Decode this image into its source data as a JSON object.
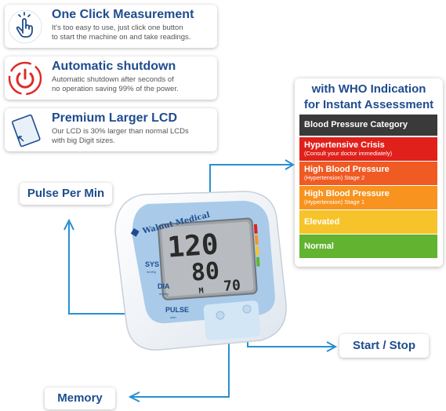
{
  "features": [
    {
      "title": "One Click Measurement",
      "line1": "It's too easy to use, just click one button",
      "line2": "to start the machine on and take readings.",
      "icon": "hand-click-icon"
    },
    {
      "title": "Automatic shutdown",
      "line1": "Automatic shutdown after seconds of",
      "line2": "no operation saving 99% of the power.",
      "icon": "power-icon"
    },
    {
      "title": "Premium Larger LCD",
      "line1": "Our LCD is 30% larger than normal LCDs",
      "line2": "with big Digit sizes.",
      "icon": "lcd-screen-icon"
    }
  ],
  "who": {
    "heading1": "with WHO Indication",
    "heading2": "for Instant Assessment",
    "categories": [
      {
        "label": "Blood Pressure Category",
        "sub": "",
        "color": "#3a3a3a"
      },
      {
        "label": "Hypertensive Crisis",
        "sub": "(Consult your doctor immediately)",
        "color": "#e0201b"
      },
      {
        "label": "High Blood Pressure",
        "sub": "(Hypertension) Stage 2",
        "color": "#f05a23"
      },
      {
        "label": "High Blood Pressure",
        "sub": "(Hypertension) Stage 1",
        "color": "#f7931e"
      },
      {
        "label": "Elevated",
        "sub": "",
        "color": "#f6c42a"
      },
      {
        "label": "Normal",
        "sub": "",
        "color": "#62b330"
      }
    ]
  },
  "callouts": {
    "pulse": "Pulse Per Min",
    "start_stop": "Start / Stop",
    "memory": "Memory"
  },
  "device": {
    "brand": "Walnut Medical",
    "sys_label": "SYS",
    "sys_unit": "mmHg",
    "dia_label": "DIA",
    "dia_unit": "mmHg",
    "pulse_label": "PULSE",
    "pulse_unit": "/min",
    "sys_value": "120",
    "dia_value": "80",
    "pulse_value": "70",
    "memory_mark": "M"
  },
  "colors": {
    "title_blue": "#1f4c8e",
    "arrow_blue": "#2a8fd1",
    "device_blue": "#a9cbe9"
  }
}
